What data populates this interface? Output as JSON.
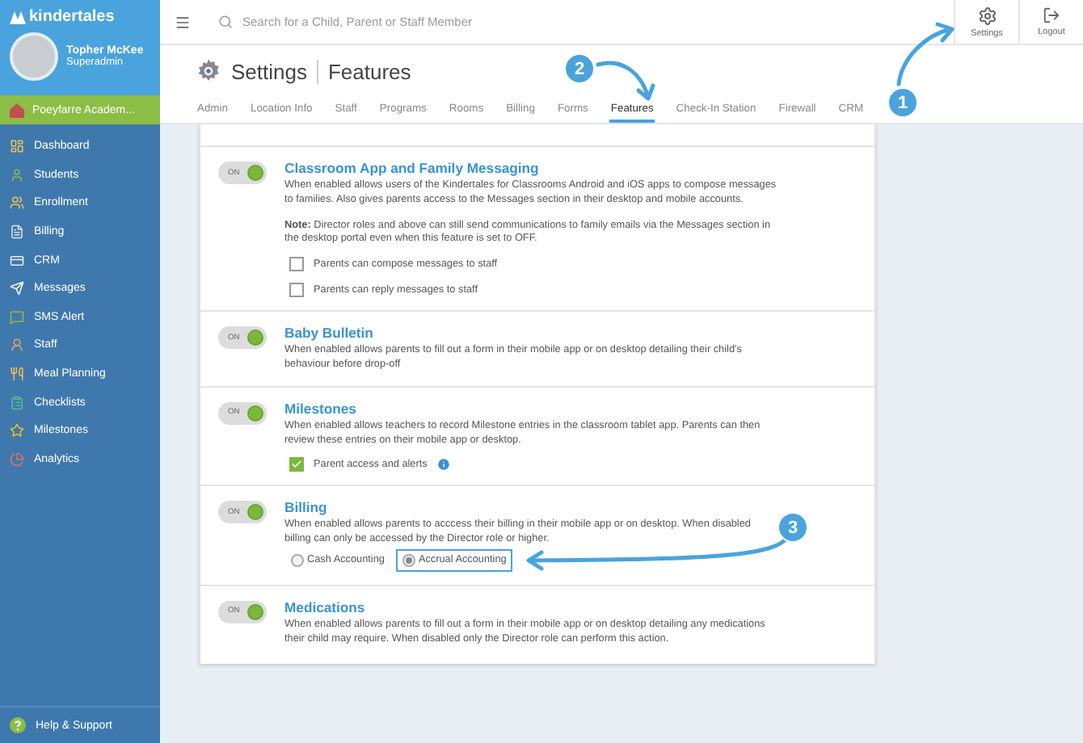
{
  "brand": {
    "name": "kindertales"
  },
  "user": {
    "name": "Topher McKee",
    "role": "Superadmin"
  },
  "location": {
    "name": "Poeyfarre Academ..."
  },
  "sidebar": {
    "items": [
      {
        "label": "Dashboard",
        "selected": false
      },
      {
        "label": "Students",
        "selected": false
      },
      {
        "label": "Enrollment",
        "selected": false
      },
      {
        "label": "Billing",
        "selected": false
      },
      {
        "label": "CRM",
        "selected": false
      },
      {
        "label": "Messages",
        "selected": false
      },
      {
        "label": "SMS Alert",
        "selected": false
      },
      {
        "label": "Staff",
        "selected": false
      },
      {
        "label": "Meal Planning",
        "selected": false
      },
      {
        "label": "Checklists",
        "selected": false
      },
      {
        "label": "Milestones",
        "selected": false
      },
      {
        "label": "Analytics",
        "selected": false
      }
    ],
    "footer": "Help & Support"
  },
  "search": {
    "placeholder": "Search for a Child, Parent or Staff Member"
  },
  "header_buttons": [
    {
      "label": "Settings",
      "kind": "settings"
    },
    {
      "label": "Logout",
      "kind": "logout"
    }
  ],
  "page": {
    "title": "Settings",
    "subtitle": "Features"
  },
  "tabs": [
    {
      "label": "Admin",
      "selected": false
    },
    {
      "label": "Location Info",
      "selected": false
    },
    {
      "label": "Staff",
      "selected": false
    },
    {
      "label": "Programs",
      "selected": false
    },
    {
      "label": "Rooms",
      "selected": false
    },
    {
      "label": "Billing",
      "selected": false
    },
    {
      "label": "Forms",
      "selected": false
    },
    {
      "label": "Features",
      "selected": true
    },
    {
      "label": "Check-In Station",
      "selected": false
    },
    {
      "label": "Firewall",
      "selected": false
    },
    {
      "label": "CRM",
      "selected": false
    }
  ],
  "features": [
    {
      "toggle": {
        "label": "ON",
        "on": true
      },
      "title": "Classroom App and Family Messaging",
      "description": "When enabled allows users of the Kindertales for Classrooms Android and iOS apps to compose messages to families. Also gives parents access to the Messages section in their desktop and mobile accounts.",
      "note": "**Note:** Director roles and above can still send communications to family emails via the Messages section in the desktop portal even when this feature is set to OFF.",
      "options": [
        {
          "kind": "checkbox",
          "label": "Parents can compose messages to staff",
          "checked": false
        },
        {
          "kind": "checkbox",
          "label": "Parents can reply messages to staff",
          "checked": false
        }
      ]
    },
    {
      "toggle": {
        "label": "ON",
        "on": true
      },
      "title": "Baby Bulletin",
      "description": "When enabled allows parents to fill out a form in their mobile app or on desktop detailing their child's behaviour before drop-off"
    },
    {
      "toggle": {
        "label": "ON",
        "on": true
      },
      "title": "Milestones",
      "description": "When enabled allows teachers to record Milestone entries in the classroom tablet app. Parents can then review these entries on their mobile app or desktop.",
      "options": [
        {
          "kind": "checkbox",
          "label": "Parent access and alerts",
          "checked": true,
          "info": true
        }
      ]
    },
    {
      "toggle": {
        "label": "ON",
        "on": true
      },
      "title": "Billing",
      "description": "When enabled allows parents to acccess their billing in their mobile app or on desktop. When disabled billing can only be accessed by the Director role or higher.",
      "options": [
        {
          "kind": "radio",
          "label": "Cash Accounting",
          "selected": false,
          "highlighted": false
        },
        {
          "kind": "radio",
          "label": "Accrual Accounting",
          "selected": true,
          "highlighted": true
        }
      ]
    },
    {
      "toggle": {
        "label": "ON",
        "on": true
      },
      "title": "Medications",
      "description": "When enabled allows parents to fill out a form in their mobile app or on desktop detailing any medications their child may require. When disabled only the Director role can perform this action."
    }
  ],
  "annotations": [
    {
      "number": "1"
    },
    {
      "number": "2"
    },
    {
      "number": "3"
    }
  ]
}
